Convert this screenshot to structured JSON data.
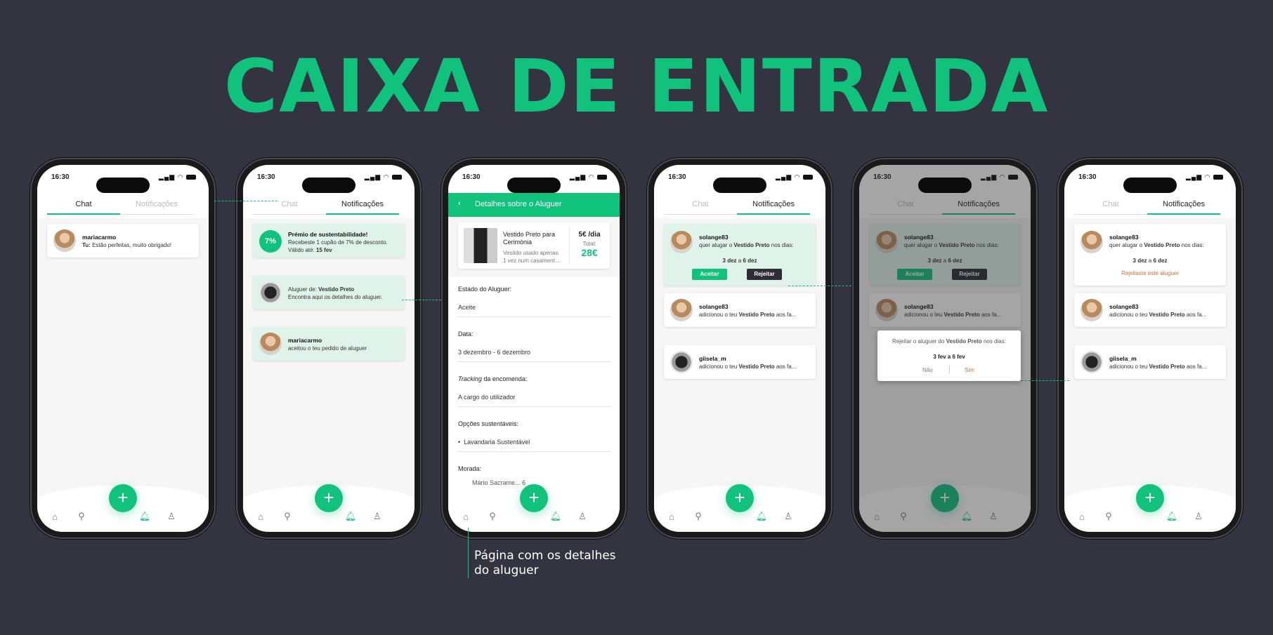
{
  "title": "CAIXA DE ENTRADA",
  "caption": "Página com os detalhes do aluguer",
  "status": {
    "time": "16:30"
  },
  "tabs": {
    "chat": "Chat",
    "notif": "Notificações"
  },
  "phone1": {
    "chat_name": "mariacarmo",
    "chat_prefix": "Tu:",
    "chat_msg": "Estão perfeitas, muito obrigado!"
  },
  "phone2": {
    "badge": "7%",
    "n1_title": "Prémio de sustentabilidade!",
    "n1_line1": "Recebeste 1 cupão de 7% de desconto.",
    "n1_line2_prefix": "Válido até:",
    "n1_line2_value": "15 fev",
    "n2_prefix": "Aluguer de:",
    "n2_item": "Vestido Preto",
    "n2_line2": "Encontra aqui os detalhes do aluguer.",
    "n3_name": "mariacarmo",
    "n3_line": "aceitou o teu pedido de aluguer"
  },
  "phone3": {
    "header": "Detalhes sobre o Aluguer",
    "product_name": "Vestido Preto para Cerimónia",
    "product_desc": "Vestido usado apenas 1 vez num casament...",
    "price_day": "5€ /dia",
    "total_label": "Total:",
    "total_value": "28€",
    "estado_label": "Estado do Aluguer:",
    "estado_value": "Aceite",
    "data_label": "Data:",
    "data_value": "3 dezembro - 6 dezembro",
    "tracking_em": "Tracking",
    "tracking_rest": "da encomenda:",
    "tracking_value": "A cargo do utilizador",
    "opcoes_label": "Opções sustentáveis:",
    "opcoes_value": "Lavandaria Sustentável",
    "morada_label": "Morada:",
    "morada_value": "Mário Sacrame... 6"
  },
  "requests": {
    "r1_name": "solange83",
    "r1_line_a": "quer alugar o",
    "r1_item": "Vestido Preto",
    "r1_line_b": "nos dias:",
    "r1_d1": "3 dez",
    "r1_a": "a",
    "r1_d2": "6 dez",
    "accept": "Aceitar",
    "reject": "Rejeitar",
    "rejected_msg": "Rejeitaste este aluguer",
    "r2_name": "solange83",
    "r2_line_a": "adicionou o teu",
    "r2_item": "Vestido Preto",
    "r2_line_b": "aos fa...",
    "r3_name": "giisela_m",
    "r3_line_a": "adicionou o teu",
    "r3_item": "Vestido Preto",
    "r3_line_b": "aos fa..."
  },
  "dialog": {
    "text_a": "Rejeitar o aluguer do",
    "item": "Vestido Preto",
    "text_b": "nos dias:",
    "dates": "3 fev a 6 fev",
    "no": "Não",
    "yes": "Sim"
  },
  "colors": {
    "accent": "#10c27c",
    "background": "#33343f",
    "dark_button": "#2c2d36",
    "rejected": "#c0703a"
  },
  "icons": [
    "home-icon",
    "search-icon",
    "bell-icon",
    "user-icon",
    "plus-icon",
    "back-chevron-icon"
  ]
}
